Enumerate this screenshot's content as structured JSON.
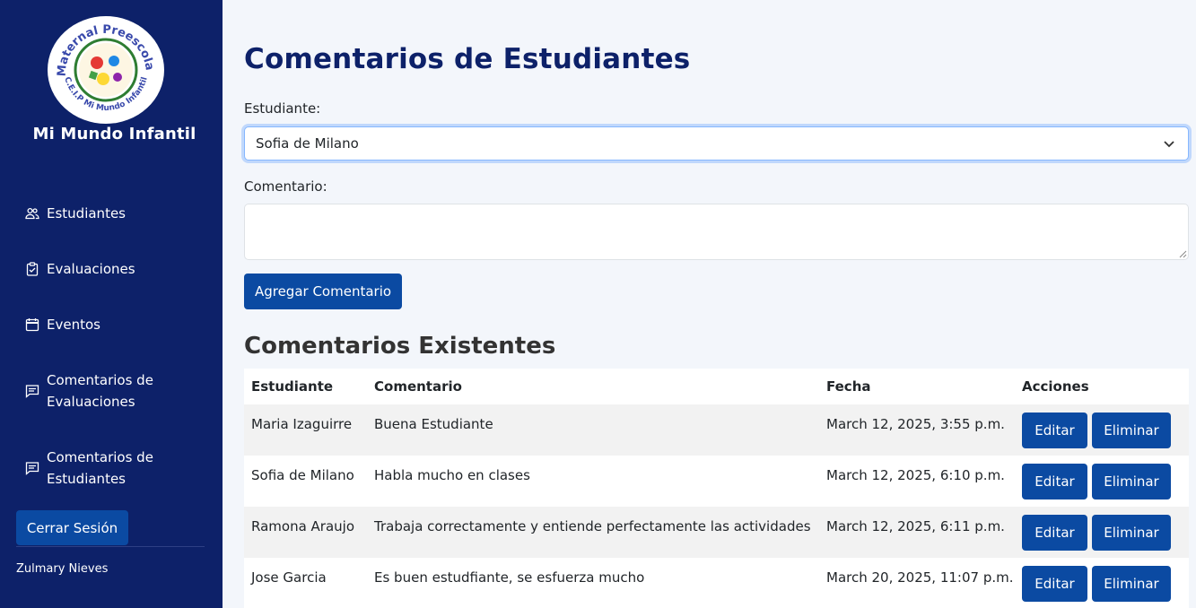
{
  "sidebar": {
    "logo": {
      "top_text": "Maternal Preescolar",
      "bottom_text": "C.E.I.P Mi Mundo Infantil"
    },
    "school_name": "Mi Mundo Infantil",
    "items": [
      {
        "label": "Estudiantes",
        "icon": "users-icon"
      },
      {
        "label": "Evaluaciones",
        "icon": "clipboard-check-icon"
      },
      {
        "label": "Eventos",
        "icon": "calendar-icon"
      },
      {
        "label": "Comentarios de Evaluaciones",
        "icon": "comment-icon"
      },
      {
        "label": "Comentarios de Estudiantes",
        "icon": "comment-icon"
      }
    ],
    "logout_label": "Cerrar Sesión",
    "user_name": "Zulmary Nieves"
  },
  "main": {
    "title": "Comentarios de Estudiantes",
    "student_label": "Estudiante:",
    "student_selected": "Sofia de Milano",
    "comment_label": "Comentario:",
    "comment_value": "",
    "add_button": "Agregar Comentario",
    "section_title": "Comentarios Existentes",
    "table": {
      "headers": [
        "Estudiante",
        "Comentario",
        "Fecha",
        "Acciones"
      ],
      "edit_label": "Editar",
      "delete_label": "Eliminar",
      "rows": [
        {
          "student": "Maria Izaguirre",
          "comment": "Buena Estudiante",
          "date": "March 12, 2025, 3:55 p.m."
        },
        {
          "student": "Sofia de Milano",
          "comment": "Habla mucho en clases",
          "date": "March 12, 2025, 6:10 p.m."
        },
        {
          "student": "Ramona Araujo",
          "comment": "Trabaja correctamente y entiende perfectamente las actividades",
          "date": "March 12, 2025, 6:11 p.m."
        },
        {
          "student": "Jose Garcia",
          "comment": "Es buen estudfiante, se esfuerza mucho",
          "date": "March 20, 2025, 11:07 p.m."
        }
      ]
    }
  },
  "colors": {
    "sidebar_bg": "#0d2169",
    "primary_button": "#0b4aa2",
    "title": "#0d2169",
    "page_bg": "#f3f6fb"
  }
}
